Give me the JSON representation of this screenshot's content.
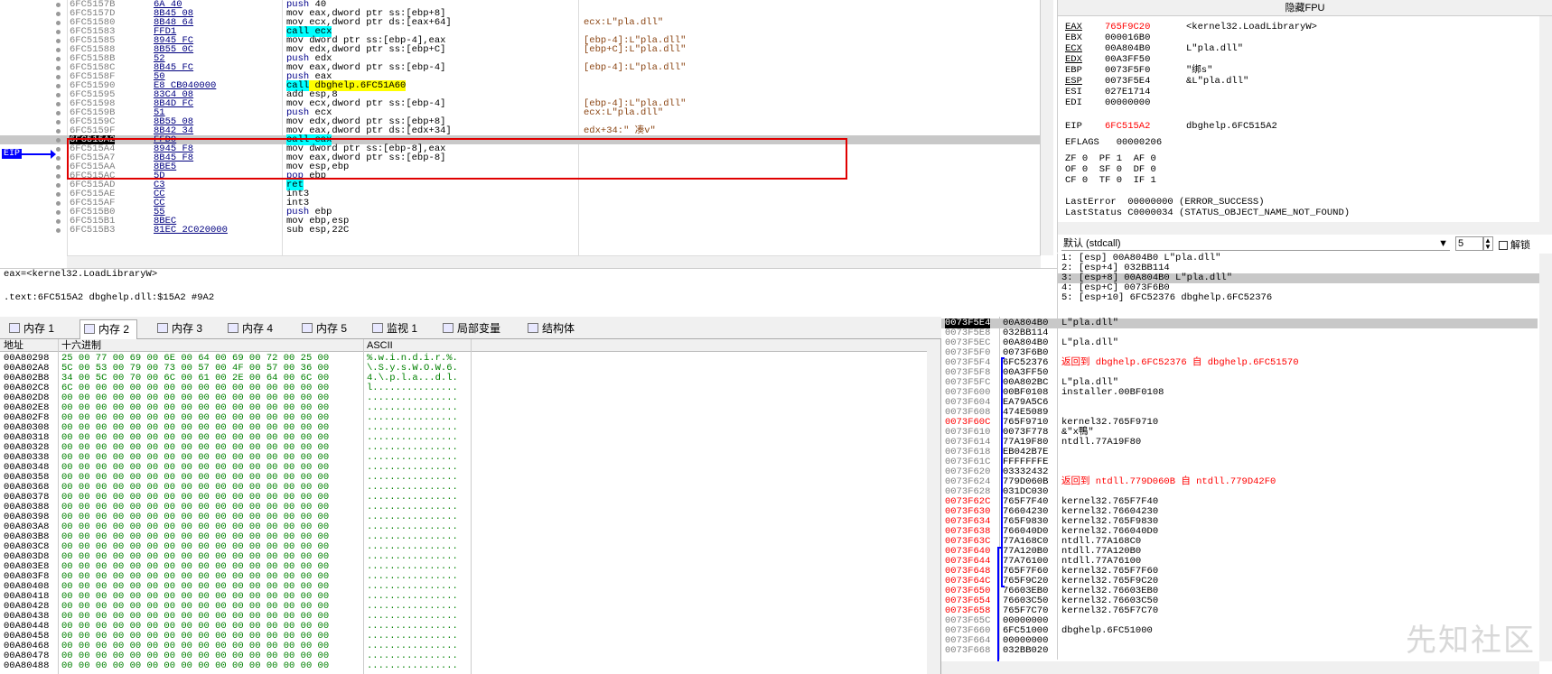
{
  "disasm": {
    "rows": [
      {
        "addr": "6FC5157B",
        "bytes": "6A 40",
        "pre": "",
        "kw": "push",
        "kwClass": "kw-push",
        "rest": " 40",
        "cmt": ""
      },
      {
        "addr": "6FC5157D",
        "bytes": "8B45 08",
        "pre": "mov eax,dword ptr ss:",
        "kw": "",
        "kwClass": "",
        "rest": "[ebp+8]",
        "cmt": ""
      },
      {
        "addr": "6FC51580",
        "bytes": "8B48 64",
        "pre": "mov ecx,dword ptr ds:",
        "kw": "",
        "kwClass": "",
        "rest": "[eax+64]",
        "cmt": "ecx:L\"pla.dll\""
      },
      {
        "addr": "6FC51583",
        "bytes": "FFD1",
        "pre": "",
        "kw": "call ecx",
        "kwClass": "kw-call",
        "rest": "",
        "cmt": ""
      },
      {
        "addr": "6FC51585",
        "bytes": "8945 FC",
        "pre": "mov dword ptr ss:",
        "kw": "",
        "kwClass": "",
        "rest": "[ebp-4],eax",
        "cmt": "[ebp-4]:L\"pla.dll\""
      },
      {
        "addr": "6FC51588",
        "bytes": "8B55 0C",
        "pre": "mov edx,dword ptr ss:",
        "kw": "",
        "kwClass": "",
        "rest": "[ebp+C]",
        "cmt": "[ebp+C]:L\"pla.dll\""
      },
      {
        "addr": "6FC5158B",
        "bytes": "52",
        "pre": "",
        "kw": "push",
        "kwClass": "kw-push",
        "rest": " edx",
        "cmt": ""
      },
      {
        "addr": "6FC5158C",
        "bytes": "8B45 FC",
        "pre": "mov eax,dword ptr ss:",
        "kw": "",
        "kwClass": "",
        "rest": "[ebp-4]",
        "cmt": "[ebp-4]:L\"pla.dll\""
      },
      {
        "addr": "6FC5158F",
        "bytes": "50",
        "pre": "",
        "kw": "push",
        "kwClass": "kw-push",
        "rest": " eax",
        "cmt": ""
      },
      {
        "addr": "6FC51590",
        "bytes": "E8 CB040000",
        "pre": "",
        "kw": "call",
        "kwClass": "kw-call",
        "rest": " dbghelp.6FC51A60",
        "cmt": ""
      },
      {
        "addr": "6FC51595",
        "bytes": "83C4 08",
        "pre": "add esp,8",
        "kw": "",
        "kwClass": "",
        "rest": "",
        "cmt": ""
      },
      {
        "addr": "6FC51598",
        "bytes": "8B4D FC",
        "pre": "mov ecx,dword ptr ss:",
        "kw": "",
        "kwClass": "",
        "rest": "[ebp-4]",
        "cmt": "[ebp-4]:L\"pla.dll\""
      },
      {
        "addr": "6FC5159B",
        "bytes": "51",
        "pre": "",
        "kw": "push",
        "kwClass": "kw-push",
        "rest": " ecx",
        "cmt": "ecx:L\"pla.dll\""
      },
      {
        "addr": "6FC5159C",
        "bytes": "8B55 08",
        "pre": "mov edx,dword ptr ss:",
        "kw": "",
        "kwClass": "",
        "rest": "[ebp+8]",
        "cmt": ""
      },
      {
        "addr": "6FC5159F",
        "bytes": "8B42 34",
        "pre": "mov eax,dword ptr ds:",
        "kw": "",
        "kwClass": "",
        "rest": "[edx+34]",
        "cmt": "edx+34:\" 凑v\""
      },
      {
        "addr": "6FC515A2",
        "bytes": "FFD0",
        "pre": "",
        "kw": "call eax",
        "kwClass": "kw-call",
        "rest": "",
        "cmt": "",
        "cur": true
      },
      {
        "addr": "6FC515A4",
        "bytes": "8945 F8",
        "pre": "mov dword ptr ss:",
        "kw": "",
        "kwClass": "",
        "rest": "[ebp-8],eax",
        "cmt": ""
      },
      {
        "addr": "6FC515A7",
        "bytes": "8B45 F8",
        "pre": "mov eax,dword ptr ss:",
        "kw": "",
        "kwClass": "",
        "rest": "[ebp-8]",
        "cmt": ""
      },
      {
        "addr": "6FC515AA",
        "bytes": "8BE5",
        "pre": "mov esp,ebp",
        "kw": "",
        "kwClass": "",
        "rest": "",
        "cmt": ""
      },
      {
        "addr": "6FC515AC",
        "bytes": "5D",
        "pre": "",
        "kw": "pop",
        "kwClass": "kw-push",
        "rest": " ebp",
        "cmt": ""
      },
      {
        "addr": "6FC515AD",
        "bytes": "C3",
        "pre": "",
        "kw": "ret",
        "kwClass": "kw-ret",
        "rest": "",
        "cmt": ""
      },
      {
        "addr": "6FC515AE",
        "bytes": "CC",
        "pre": "int3",
        "kw": "",
        "kwClass": "",
        "rest": "",
        "cmt": ""
      },
      {
        "addr": "6FC515AF",
        "bytes": "CC",
        "pre": "int3",
        "kw": "",
        "kwClass": "",
        "rest": "",
        "cmt": ""
      },
      {
        "addr": "6FC515B0",
        "bytes": "55",
        "pre": "",
        "kw": "push",
        "kwClass": "kw-push",
        "rest": " ebp",
        "cmt": ""
      },
      {
        "addr": "6FC515B1",
        "bytes": "8BEC",
        "pre": "mov ebp,esp",
        "kw": "",
        "kwClass": "",
        "rest": "",
        "cmt": ""
      },
      {
        "addr": "6FC515B3",
        "bytes": "81EC 2C020000",
        "pre": "sub esp,22C",
        "kw": "",
        "kwClass": "",
        "rest": "",
        "cmt": ""
      }
    ],
    "eip_label": "EIP"
  },
  "info": {
    "line1": "eax=<kernel32.LoadLibraryW>",
    "line2": "",
    "line3": ".text:6FC515A2 dbghelp.dll:$15A2 #9A2"
  },
  "registers": {
    "title": "隐藏FPU",
    "rows": [
      {
        "n": "EAX",
        "v": "765F9C20",
        "c": "<kernel32.LoadLibraryW>",
        "chg": true,
        "ul": true
      },
      {
        "n": "EBX",
        "v": "000016B0",
        "c": "",
        "chg": false,
        "ul": false
      },
      {
        "n": "ECX",
        "v": "00A804B0",
        "c": "L\"pla.dll\"",
        "chg": false,
        "ul": true
      },
      {
        "n": "EDX",
        "v": "00A3FF50",
        "c": "",
        "chg": false,
        "ul": true
      },
      {
        "n": "EBP",
        "v": "0073F5F0",
        "c": "\"绑s\"",
        "chg": false,
        "ul": false
      },
      {
        "n": "ESP",
        "v": "0073F5E4",
        "c": "&L\"pla.dll\"",
        "chg": false,
        "ul": true
      },
      {
        "n": "ESI",
        "v": "027E1714",
        "c": "",
        "chg": false,
        "ul": false
      },
      {
        "n": "EDI",
        "v": "00000000",
        "c": "",
        "chg": false,
        "ul": false
      }
    ],
    "eip": {
      "n": "EIP",
      "v": "6FC515A2",
      "c": "dbghelp.6FC515A2"
    },
    "eflags": "EFLAGS   00000206",
    "flags1": "ZF 0  PF 1  AF 0",
    "flags2": "OF 0  SF 0  DF 0",
    "flags3": "CF 0  TF 0  IF 1",
    "lasterror": "LastError  00000000 (ERROR_SUCCESS)",
    "laststatus": "LastStatus C0000034 (STATUS_OBJECT_NAME_NOT_FOUND)"
  },
  "callconv": {
    "label": "默认 (stdcall)",
    "count": "5",
    "unlock": "解锁"
  },
  "args": [
    "1: [esp] 00A804B0 L\"pla.dll\"",
    "2: [esp+4] 032BB114",
    "3: [esp+8] 00A804B0 L\"pla.dll\"",
    "4: [esp+C] 0073F6B0",
    "5: [esp+10] 6FC52376 dbghelp.6FC52376"
  ],
  "tabs": [
    {
      "label": "内存 1",
      "icon": "memory-icon"
    },
    {
      "label": "内存 2",
      "icon": "memory-icon"
    },
    {
      "label": "内存 3",
      "icon": "memory-icon"
    },
    {
      "label": "内存 4",
      "icon": "memory-icon"
    },
    {
      "label": "内存 5",
      "icon": "memory-icon"
    },
    {
      "label": "监视 1",
      "icon": "watch-icon"
    },
    {
      "label": "局部变量",
      "icon": "locals-icon"
    },
    {
      "label": "结构体",
      "icon": "struct-icon"
    }
  ],
  "dump": {
    "headers": {
      "addr": "地址",
      "hex": "十六进制",
      "ascii": "ASCII"
    },
    "rows": [
      {
        "a": "00A80298",
        "h": "25 00 77 00 69 00 6E 00 64 00 69 00 72 00 25 00",
        "s": "%.w.i.n.d.i.r.%."
      },
      {
        "a": "00A802A8",
        "h": "5C 00 53 00 79 00 73 00 57 00 4F 00 57 00 36 00",
        "s": "\\.S.y.s.W.O.W.6."
      },
      {
        "a": "00A802B8",
        "h": "34 00 5C 00 70 00 6C 00 61 00 2E 00 64 00 6C 00",
        "s": "4.\\.p.l.a...d.l."
      },
      {
        "a": "00A802C8",
        "h": "6C 00 00 00 00 00 00 00 00 00 00 00 00 00 00 00",
        "s": "l..............."
      },
      {
        "a": "00A802D8",
        "h": "00 00 00 00 00 00 00 00 00 00 00 00 00 00 00 00",
        "s": "................"
      },
      {
        "a": "00A802E8",
        "h": "00 00 00 00 00 00 00 00 00 00 00 00 00 00 00 00",
        "s": "................"
      },
      {
        "a": "00A802F8",
        "h": "00 00 00 00 00 00 00 00 00 00 00 00 00 00 00 00",
        "s": "................"
      },
      {
        "a": "00A80308",
        "h": "00 00 00 00 00 00 00 00 00 00 00 00 00 00 00 00",
        "s": "................"
      },
      {
        "a": "00A80318",
        "h": "00 00 00 00 00 00 00 00 00 00 00 00 00 00 00 00",
        "s": "................"
      },
      {
        "a": "00A80328",
        "h": "00 00 00 00 00 00 00 00 00 00 00 00 00 00 00 00",
        "s": "................"
      },
      {
        "a": "00A80338",
        "h": "00 00 00 00 00 00 00 00 00 00 00 00 00 00 00 00",
        "s": "................"
      },
      {
        "a": "00A80348",
        "h": "00 00 00 00 00 00 00 00 00 00 00 00 00 00 00 00",
        "s": "................"
      },
      {
        "a": "00A80358",
        "h": "00 00 00 00 00 00 00 00 00 00 00 00 00 00 00 00",
        "s": "................"
      },
      {
        "a": "00A80368",
        "h": "00 00 00 00 00 00 00 00 00 00 00 00 00 00 00 00",
        "s": "................"
      },
      {
        "a": "00A80378",
        "h": "00 00 00 00 00 00 00 00 00 00 00 00 00 00 00 00",
        "s": "................"
      },
      {
        "a": "00A80388",
        "h": "00 00 00 00 00 00 00 00 00 00 00 00 00 00 00 00",
        "s": "................"
      },
      {
        "a": "00A80398",
        "h": "00 00 00 00 00 00 00 00 00 00 00 00 00 00 00 00",
        "s": "................"
      },
      {
        "a": "00A803A8",
        "h": "00 00 00 00 00 00 00 00 00 00 00 00 00 00 00 00",
        "s": "................"
      },
      {
        "a": "00A803B8",
        "h": "00 00 00 00 00 00 00 00 00 00 00 00 00 00 00 00",
        "s": "................"
      },
      {
        "a": "00A803C8",
        "h": "00 00 00 00 00 00 00 00 00 00 00 00 00 00 00 00",
        "s": "................"
      },
      {
        "a": "00A803D8",
        "h": "00 00 00 00 00 00 00 00 00 00 00 00 00 00 00 00",
        "s": "................"
      },
      {
        "a": "00A803E8",
        "h": "00 00 00 00 00 00 00 00 00 00 00 00 00 00 00 00",
        "s": "................"
      },
      {
        "a": "00A803F8",
        "h": "00 00 00 00 00 00 00 00 00 00 00 00 00 00 00 00",
        "s": "................"
      },
      {
        "a": "00A80408",
        "h": "00 00 00 00 00 00 00 00 00 00 00 00 00 00 00 00",
        "s": "................"
      },
      {
        "a": "00A80418",
        "h": "00 00 00 00 00 00 00 00 00 00 00 00 00 00 00 00",
        "s": "................"
      },
      {
        "a": "00A80428",
        "h": "00 00 00 00 00 00 00 00 00 00 00 00 00 00 00 00",
        "s": "................"
      },
      {
        "a": "00A80438",
        "h": "00 00 00 00 00 00 00 00 00 00 00 00 00 00 00 00",
        "s": "................"
      },
      {
        "a": "00A80448",
        "h": "00 00 00 00 00 00 00 00 00 00 00 00 00 00 00 00",
        "s": "................"
      },
      {
        "a": "00A80458",
        "h": "00 00 00 00 00 00 00 00 00 00 00 00 00 00 00 00",
        "s": "................"
      },
      {
        "a": "00A80468",
        "h": "00 00 00 00 00 00 00 00 00 00 00 00 00 00 00 00",
        "s": "................"
      },
      {
        "a": "00A80478",
        "h": "00 00 00 00 00 00 00 00 00 00 00 00 00 00 00 00",
        "s": "................"
      },
      {
        "a": "00A80488",
        "h": "00 00 00 00 00 00 00 00 00 00 00 00 00 00 00 00",
        "s": "................"
      }
    ]
  },
  "stack": {
    "rows": [
      {
        "a": "0073F5E4",
        "v": "00A804B0",
        "c": "L\"pla.dll\"",
        "top": true
      },
      {
        "a": "0073F5E8",
        "v": "032BB114",
        "c": ""
      },
      {
        "a": "0073F5EC",
        "v": "00A804B0",
        "c": "L\"pla.dll\""
      },
      {
        "a": "0073F5F0",
        "v": "0073F6B0",
        "c": ""
      },
      {
        "a": "0073F5F4",
        "v": "6FC52376",
        "c": "返回到 dbghelp.6FC52376 自 dbghelp.6FC51570",
        "ret": true
      },
      {
        "a": "0073F5F8",
        "v": "00A3FF50",
        "c": ""
      },
      {
        "a": "0073F5FC",
        "v": "00A802BC",
        "c": "L\"pla.dll\""
      },
      {
        "a": "0073F600",
        "v": "00BF0108",
        "c": "installer.00BF0108"
      },
      {
        "a": "0073F604",
        "v": "EA79A5C6",
        "c": ""
      },
      {
        "a": "0073F608",
        "v": "474E5089",
        "c": ""
      },
      {
        "a": "0073F60C",
        "v": "765F9710",
        "c": "kernel32.765F9710",
        "red": true
      },
      {
        "a": "0073F610",
        "v": "0073F778",
        "c": "&\"x鴨\""
      },
      {
        "a": "0073F614",
        "v": "77A19F80",
        "c": "ntdll.77A19F80"
      },
      {
        "a": "0073F618",
        "v": "EB042B7E",
        "c": ""
      },
      {
        "a": "0073F61C",
        "v": "FFFFFFFE",
        "c": ""
      },
      {
        "a": "0073F620",
        "v": "03332432",
        "c": ""
      },
      {
        "a": "0073F624",
        "v": "779D060B",
        "c": "返回到 ntdll.779D060B 自 ntdll.779D42F0",
        "ret": true
      },
      {
        "a": "0073F628",
        "v": "031DC030",
        "c": ""
      },
      {
        "a": "0073F62C",
        "v": "765F7F40",
        "c": "kernel32.765F7F40",
        "red": true
      },
      {
        "a": "0073F630",
        "v": "76604230",
        "c": "kernel32.76604230",
        "red": true
      },
      {
        "a": "0073F634",
        "v": "765F9830",
        "c": "kernel32.765F9830",
        "red": true
      },
      {
        "a": "0073F638",
        "v": "766040D0",
        "c": "kernel32.766040D0",
        "red": true
      },
      {
        "a": "0073F63C",
        "v": "77A168C0",
        "c": "ntdll.77A168C0",
        "red": true
      },
      {
        "a": "0073F640",
        "v": "77A120B0",
        "c": "ntdll.77A120B0",
        "red": true
      },
      {
        "a": "0073F644",
        "v": "77A76100",
        "c": "ntdll.77A76100",
        "red": true
      },
      {
        "a": "0073F648",
        "v": "765F7F60",
        "c": "kernel32.765F7F60",
        "red": true
      },
      {
        "a": "0073F64C",
        "v": "765F9C20",
        "c": "kernel32.765F9C20",
        "red": true
      },
      {
        "a": "0073F650",
        "v": "76603EB0",
        "c": "kernel32.76603EB0",
        "red": true
      },
      {
        "a": "0073F654",
        "v": "76603C50",
        "c": "kernel32.76603C50",
        "red": true
      },
      {
        "a": "0073F658",
        "v": "765F7C70",
        "c": "kernel32.765F7C70",
        "red": true
      },
      {
        "a": "0073F65C",
        "v": "00000000",
        "c": ""
      },
      {
        "a": "0073F660",
        "v": "6FC51000",
        "c": "dbghelp.6FC51000"
      },
      {
        "a": "0073F664",
        "v": "00000000",
        "c": ""
      },
      {
        "a": "0073F668",
        "v": "032BB020",
        "c": ""
      }
    ],
    "watermark": "先知社区"
  }
}
